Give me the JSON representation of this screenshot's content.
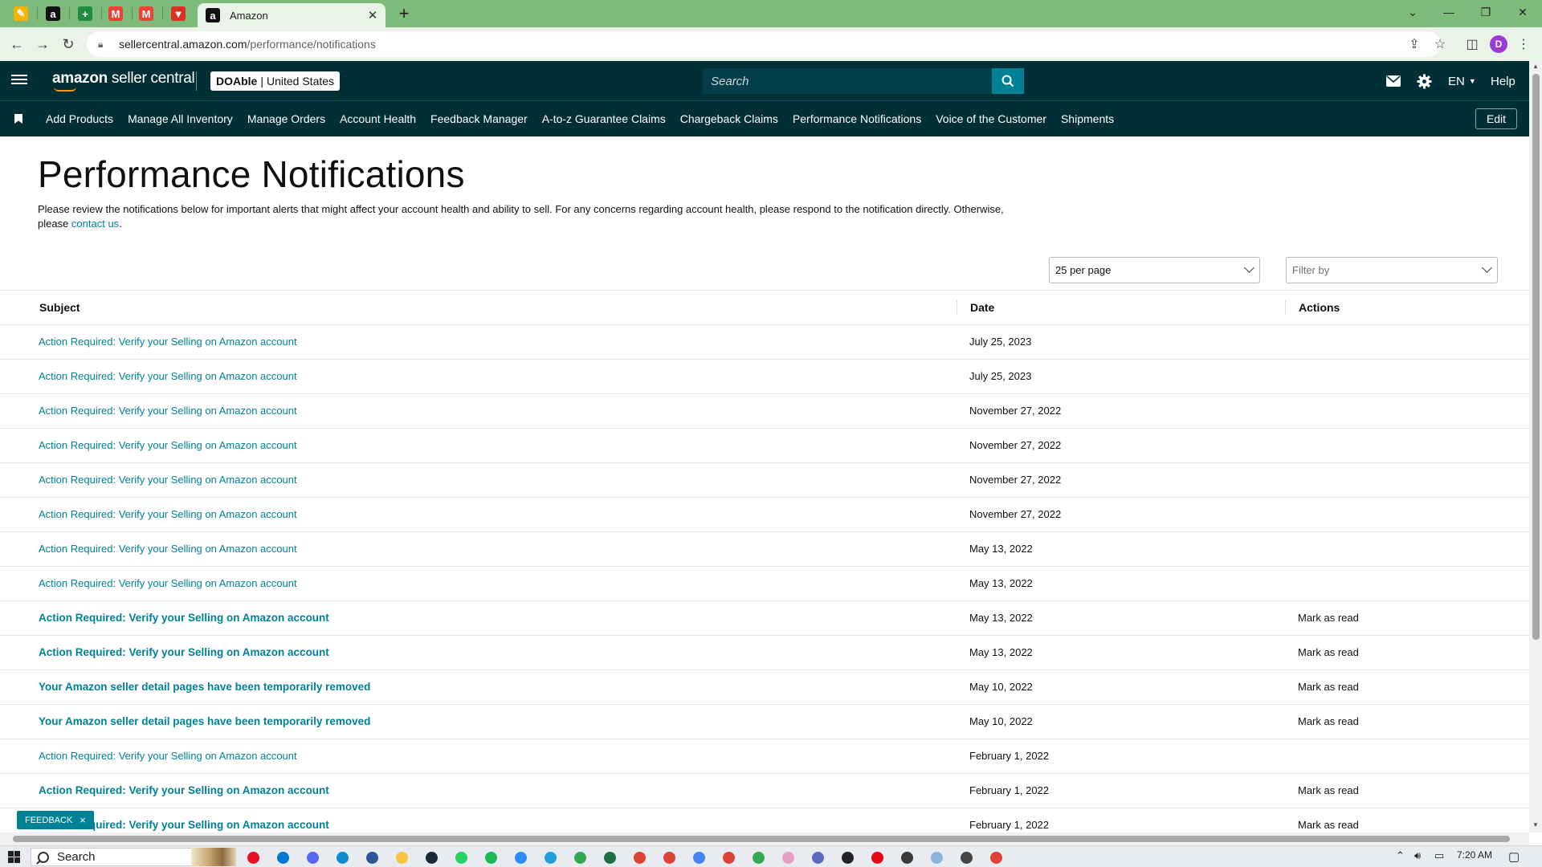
{
  "browser": {
    "active_tab_title": "Amazon",
    "url_host": "sellercentral.amazon.com",
    "url_path": "/performance/notifications",
    "profile_initial": "D",
    "pinned_tabs": [
      {
        "icon": "pencil-colorful-icon",
        "color": "#f6b400",
        "glyph": "✎"
      },
      {
        "icon": "amazon-icon",
        "color": "#111111",
        "glyph": "a"
      },
      {
        "icon": "plus-sheet-icon",
        "color": "#1e8e3e",
        "glyph": "+"
      },
      {
        "icon": "gmail-icon",
        "color": "#ea4335",
        "glyph": "M"
      },
      {
        "icon": "gmail-icon",
        "color": "#ea4335",
        "glyph": "M"
      },
      {
        "icon": "shield-v-icon",
        "color": "#d93025",
        "glyph": "▼"
      }
    ]
  },
  "header": {
    "logo_brand": "amazon",
    "logo_product": " seller central",
    "account_name": "DOAble",
    "account_sep": "|",
    "marketplace": "United States",
    "search_placeholder": "Search",
    "language": "EN",
    "help": "Help"
  },
  "nav": {
    "items": [
      "Add Products",
      "Manage All Inventory",
      "Manage Orders",
      "Account Health",
      "Feedback Manager",
      "A-to-z Guarantee Claims",
      "Chargeback Claims",
      "Performance Notifications",
      "Voice of the Customer",
      "Shipments"
    ],
    "edit": "Edit"
  },
  "page": {
    "title": "Performance Notifications",
    "intro_text": "Please review the notifications below for important alerts that might affect your account health and ability to sell. For any concerns regarding account health, please respond to the notification directly. Otherwise, please ",
    "intro_link": "contact us",
    "intro_end": ".",
    "per_page": "25 per page",
    "filter_placeholder": "Filter by"
  },
  "table": {
    "headers": {
      "subject": "Subject",
      "date": "Date",
      "actions": "Actions"
    },
    "rows": [
      {
        "subject": "Action Required: Verify your Selling on Amazon account",
        "date": "July 25, 2023",
        "action": "",
        "unread": false
      },
      {
        "subject": "Action Required: Verify your Selling on Amazon account",
        "date": "July 25, 2023",
        "action": "",
        "unread": false
      },
      {
        "subject": "Action Required: Verify your Selling on Amazon account",
        "date": "November 27, 2022",
        "action": "",
        "unread": false
      },
      {
        "subject": "Action Required: Verify your Selling on Amazon account",
        "date": "November 27, 2022",
        "action": "",
        "unread": false
      },
      {
        "subject": "Action Required: Verify your Selling on Amazon account",
        "date": "November 27, 2022",
        "action": "",
        "unread": false
      },
      {
        "subject": "Action Required: Verify your Selling on Amazon account",
        "date": "November 27, 2022",
        "action": "",
        "unread": false
      },
      {
        "subject": "Action Required: Verify your Selling on Amazon account",
        "date": "May 13, 2022",
        "action": "",
        "unread": false
      },
      {
        "subject": "Action Required: Verify your Selling on Amazon account",
        "date": "May 13, 2022",
        "action": "",
        "unread": false
      },
      {
        "subject": "Action Required: Verify your Selling on Amazon account",
        "date": "May 13, 2022",
        "action": "Mark as read",
        "unread": true
      },
      {
        "subject": "Action Required: Verify your Selling on Amazon account",
        "date": "May 13, 2022",
        "action": "Mark as read",
        "unread": true
      },
      {
        "subject": "Your Amazon seller detail pages have been temporarily removed",
        "date": "May 10, 2022",
        "action": "Mark as read",
        "unread": true
      },
      {
        "subject": "Your Amazon seller detail pages have been temporarily removed",
        "date": "May 10, 2022",
        "action": "Mark as read",
        "unread": true
      },
      {
        "subject": "Action Required: Verify your Selling on Amazon account",
        "date": "February 1, 2022",
        "action": "",
        "unread": false
      },
      {
        "subject": "Action Required: Verify your Selling on Amazon account",
        "date": "February 1, 2022",
        "action": "Mark as read",
        "unread": true
      },
      {
        "subject": "Action Required: Verify your Selling on Amazon account",
        "date": "February 1, 2022",
        "action": "Mark as read",
        "unread": true
      }
    ]
  },
  "feedback": {
    "label": "FEEDBACK",
    "close": "×"
  },
  "taskbar": {
    "search_label": "Search",
    "time": "7:20 AM",
    "apps": [
      {
        "icon": "record-icon",
        "color": "#e81123",
        "active": false
      },
      {
        "icon": "mail-icon",
        "color": "#0078d4",
        "active": false
      },
      {
        "icon": "discord-icon",
        "color": "#5865f2",
        "active": false
      },
      {
        "icon": "edge-icon",
        "color": "#0c8bd0",
        "active": false
      },
      {
        "icon": "store-icon",
        "color": "#2b5797",
        "active": false
      },
      {
        "icon": "folder-icon",
        "color": "#f6c343",
        "active": true
      },
      {
        "icon": "steam-icon",
        "color": "#1b2838",
        "active": false
      },
      {
        "icon": "whatsapp-icon",
        "color": "#25d366",
        "active": false
      },
      {
        "icon": "spotify-icon",
        "color": "#1db954",
        "active": false
      },
      {
        "icon": "zoom-icon",
        "color": "#2d8cff",
        "active": false
      },
      {
        "icon": "telegram-icon",
        "color": "#229ed9",
        "active": false
      },
      {
        "icon": "chrome-icon",
        "color": "#34a853",
        "active": false
      },
      {
        "icon": "excel-icon",
        "color": "#1d6f42",
        "active": false
      },
      {
        "icon": "chrome-icon",
        "color": "#db4437",
        "active": true
      },
      {
        "icon": "chrome-icon",
        "color": "#db4437",
        "active": true
      },
      {
        "icon": "chrome-icon",
        "color": "#4285f4",
        "active": true
      },
      {
        "icon": "chrome-icon",
        "color": "#db4437",
        "active": true
      },
      {
        "icon": "chrome-icon",
        "color": "#34a853",
        "active": false
      },
      {
        "icon": "paint-icon",
        "color": "#e5a0c4",
        "active": false
      },
      {
        "icon": "calculator-icon",
        "color": "#5c6bc0",
        "active": true
      },
      {
        "icon": "obs-icon",
        "color": "#222222",
        "active": false
      },
      {
        "icon": "netflix-icon",
        "color": "#e50914",
        "active": false
      },
      {
        "icon": "terminal-icon",
        "color": "#3a3a3a",
        "active": false
      },
      {
        "icon": "notepad-icon",
        "color": "#8ab4d8",
        "active": false
      },
      {
        "icon": "settings-icon",
        "color": "#444444",
        "active": false
      },
      {
        "icon": "chrome-icon",
        "color": "#db4437",
        "active": true
      }
    ]
  }
}
